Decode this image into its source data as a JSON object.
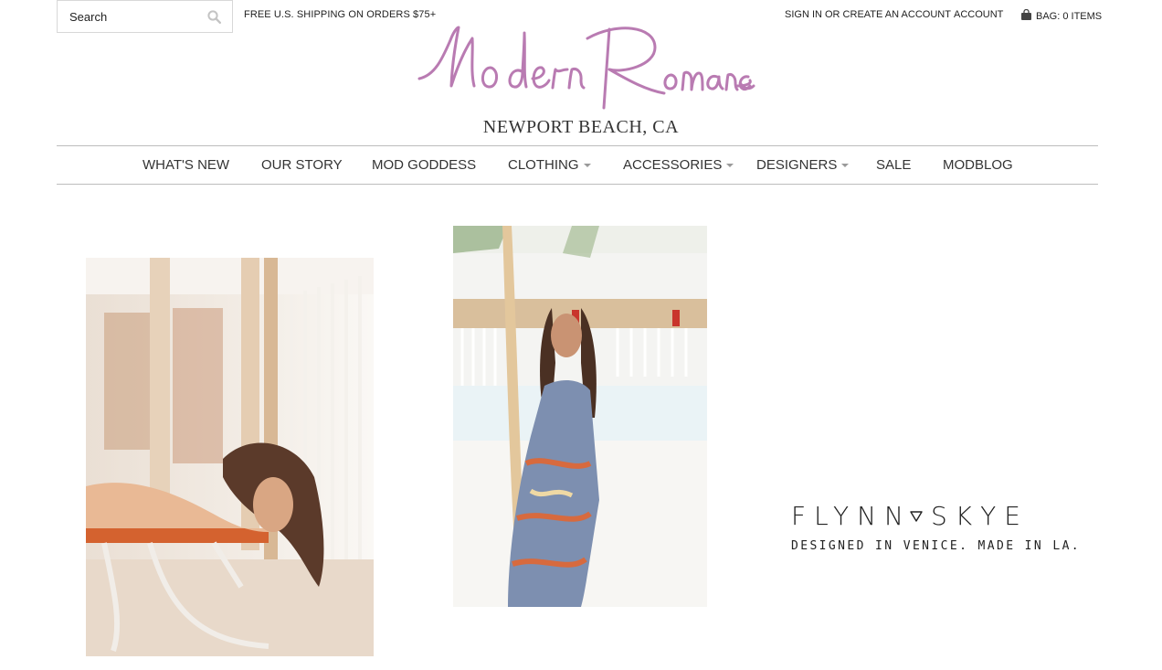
{
  "header": {
    "search": {
      "placeholder": "Search"
    },
    "promo": "FREE U.S. SHIPPING ON ORDERS $75+",
    "signin": "SIGN IN OR CREATE AN ACCOUNT",
    "account": "ACCOUNT",
    "bag": "BAG: 0 ITEMS",
    "logo_text": "Modern Romance",
    "location": "NEWPORT BEACH, CA",
    "logo_color": "#b97bb2"
  },
  "nav": {
    "items": [
      {
        "label": "WHAT'S NEW"
      },
      {
        "label": "OUR STORY"
      },
      {
        "label": "MOD GODDESS"
      },
      {
        "label": "CLOTHING"
      },
      {
        "label": "ACCESSORIES"
      },
      {
        "label": "DESIGNERS"
      },
      {
        "label": "SALE"
      },
      {
        "label": "MODBLOG"
      }
    ]
  },
  "feature": {
    "brand_left": "FLYNN",
    "brand_right": "SKYE",
    "tagline": "DESIGNED IN VENICE. MADE IN LA."
  }
}
